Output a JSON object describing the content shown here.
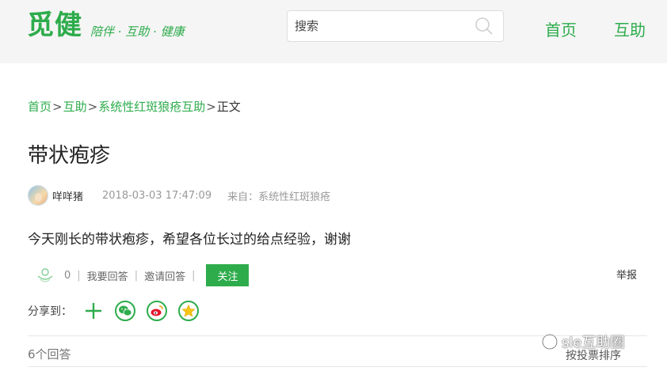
{
  "header": {
    "logo_text": "觅健",
    "slogan": "陪伴 · 互助 · 健康",
    "search": {
      "placeholder": "搜索"
    },
    "nav": {
      "home": "首页",
      "help": "互助"
    }
  },
  "breadcrumb": {
    "items": [
      "首页",
      "互助",
      "系统性红斑狼疮互助"
    ],
    "separator": ">",
    "current": "正文"
  },
  "post": {
    "title": "带状疱疹",
    "author": "咩咩猪",
    "time": "2018-03-03 17:47:09",
    "source": "来自：系统性红斑狼疮",
    "content": "今天刚长的带状疱疹，希望各位长过的给点经验，谢谢"
  },
  "actions": {
    "like_count": "0",
    "answer_label": "我要回答",
    "invite_label": "邀请回答",
    "follow_label": "关注",
    "report_label": "举报",
    "separator": "|"
  },
  "share": {
    "label": "分享到：",
    "icons": [
      "plus-icon",
      "wechat-icon",
      "weibo-icon",
      "qzone-icon"
    ]
  },
  "answers": {
    "count_label": "6个回答",
    "sort_label": "按投票排序"
  },
  "watermark": {
    "text": "sle互助圈"
  },
  "colors": {
    "brand": "#2eac4c",
    "header_bg": "#f5f5f5"
  }
}
